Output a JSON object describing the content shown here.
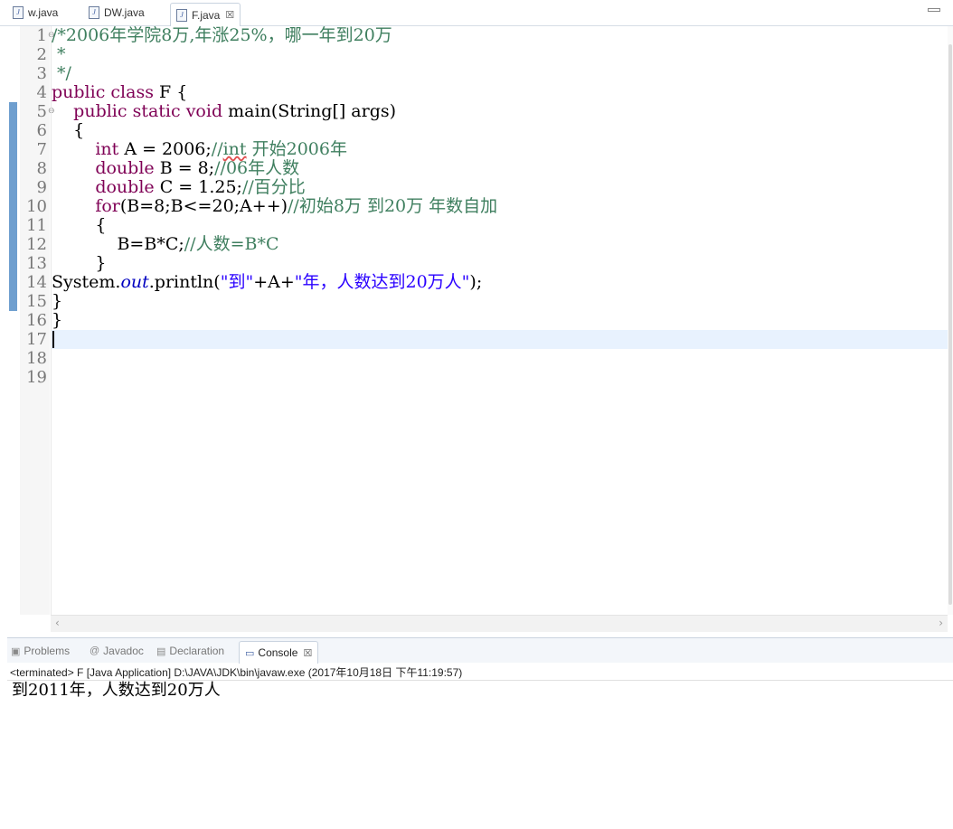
{
  "editor_tabs": [
    {
      "label": "w.java",
      "active": false
    },
    {
      "label": "DW.java",
      "active": false
    },
    {
      "label": "F.java",
      "active": true,
      "close": "☒"
    }
  ],
  "line_numbers": [
    "1",
    "2",
    "3",
    "4",
    "5",
    "6",
    "7",
    "8",
    "9",
    "10",
    "11",
    "12",
    "13",
    "14",
    "15",
    "16",
    "17",
    "18",
    "19"
  ],
  "code_lines": [
    [
      {
        "t": "/*2006年学院8万,年涨25%，哪一年到20万",
        "c": "cm"
      }
    ],
    [
      {
        "t": " *",
        "c": "cm"
      }
    ],
    [
      {
        "t": " */",
        "c": "cm"
      }
    ],
    [
      {
        "t": "public",
        "c": "kw"
      },
      {
        "t": " "
      },
      {
        "t": "class",
        "c": "kw"
      },
      {
        "t": " F {"
      }
    ],
    [
      {
        "t": "    "
      },
      {
        "t": "public",
        "c": "kw"
      },
      {
        "t": " "
      },
      {
        "t": "static",
        "c": "kw"
      },
      {
        "t": " "
      },
      {
        "t": "void",
        "c": "kw"
      },
      {
        "t": " main(String[] args)"
      }
    ],
    [
      {
        "t": "    {"
      }
    ],
    [
      {
        "t": "        "
      },
      {
        "t": "int",
        "c": "kw"
      },
      {
        "t": " A = 2006;"
      },
      {
        "t": "//",
        "c": "cm"
      },
      {
        "t": "int",
        "c": "cm sq"
      },
      {
        "t": " 开始2006年",
        "c": "cm"
      }
    ],
    [
      {
        "t": "        "
      },
      {
        "t": "double",
        "c": "kw"
      },
      {
        "t": " B = 8;"
      },
      {
        "t": "//06年人数",
        "c": "cm"
      }
    ],
    [
      {
        "t": "        "
      },
      {
        "t": "double",
        "c": "kw"
      },
      {
        "t": " C = 1.25;"
      },
      {
        "t": "//百分比",
        "c": "cm"
      }
    ],
    [
      {
        "t": "        "
      },
      {
        "t": "for",
        "c": "kw"
      },
      {
        "t": "(B=8;B<=20;A++)"
      },
      {
        "t": "//初始8万 到20万 年数自加",
        "c": "cm"
      }
    ],
    [
      {
        "t": "        {"
      }
    ],
    [
      {
        "t": "            B=B*C;"
      },
      {
        "t": "//人数=B*C",
        "c": "cm"
      }
    ],
    [
      {
        "t": "        }"
      }
    ],
    [
      {
        "t": "System."
      },
      {
        "t": "out",
        "c": "fld"
      },
      {
        "t": ".println("
      },
      {
        "t": "\"到\"",
        "c": "st"
      },
      {
        "t": "+A+"
      },
      {
        "t": "\"年，人数达到20万人\"",
        "c": "st"
      },
      {
        "t": ");"
      }
    ],
    [
      {
        "t": "}"
      }
    ],
    [
      {
        "t": "}"
      }
    ],
    [
      {
        "t": ""
      }
    ],
    [
      {
        "t": ""
      }
    ],
    [
      {
        "t": ""
      }
    ]
  ],
  "view_tabs": [
    {
      "label": "Problems",
      "icon": "problems-icon",
      "active": false
    },
    {
      "label": "Javadoc",
      "icon": "javadoc-icon",
      "active": false
    },
    {
      "label": "Declaration",
      "icon": "declaration-icon",
      "active": false
    },
    {
      "label": "Console",
      "icon": "console-icon",
      "active": true,
      "close": "☒"
    }
  ],
  "console": {
    "status": "<terminated> F [Java Application] D:\\JAVA\\JDK\\bin\\javaw.exe (2017年10月18日 下午11:19:57)",
    "output": "到2011年，人数达到20万人"
  },
  "colors": {
    "keyword": "#7f0055",
    "comment": "#3f7f5f",
    "string": "#2a00ff",
    "field": "#0000c0",
    "current_line": "#e8f2fe",
    "ruler_mark": "#6f9fcf"
  }
}
